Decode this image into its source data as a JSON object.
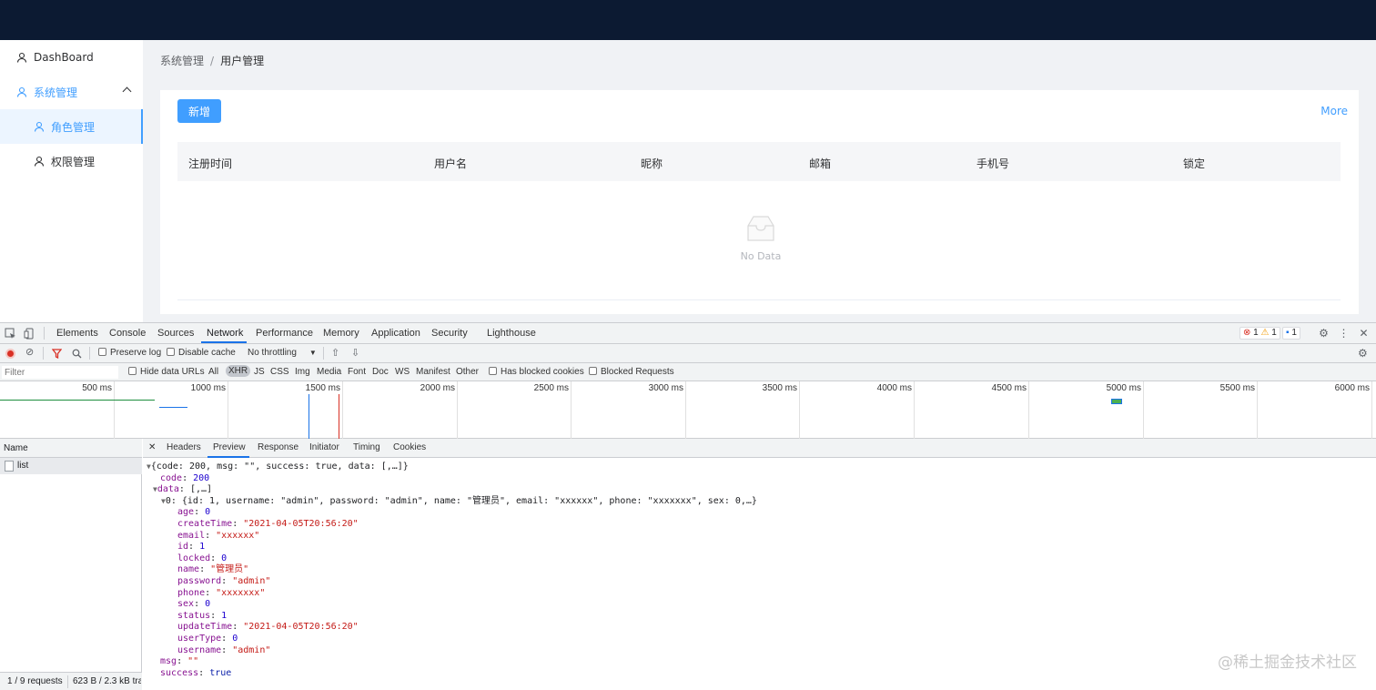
{
  "sidebar": {
    "items": [
      {
        "label": "DashBoard"
      },
      {
        "label": "系统管理"
      },
      {
        "label": "角色管理"
      },
      {
        "label": "权限管理"
      }
    ]
  },
  "breadcrumb": {
    "parent": "系统管理",
    "separator": "/",
    "current": "用户管理"
  },
  "card": {
    "add_label": "新增",
    "more_label": "More",
    "columns": [
      "注册时间",
      "用户名",
      "昵称",
      "邮箱",
      "手机号",
      "锁定"
    ],
    "empty_text": "No Data"
  },
  "devtools": {
    "tabs": [
      "Elements",
      "Console",
      "Sources",
      "Network",
      "Performance",
      "Memory",
      "Application",
      "Security",
      "Lighthouse"
    ],
    "active_tab": "Network",
    "badges": {
      "errors": "1",
      "warnings": "1",
      "messages": "1"
    },
    "toolbar": {
      "preserve_log": "Preserve log",
      "disable_cache": "Disable cache",
      "throttling": "No throttling"
    },
    "filter": {
      "placeholder": "Filter",
      "hide_data_urls": "Hide data URLs",
      "types": [
        "All",
        "XHR",
        "JS",
        "CSS",
        "Img",
        "Media",
        "Font",
        "Doc",
        "WS",
        "Manifest",
        "Other"
      ],
      "active_type": "XHR",
      "has_blocked_cookies": "Has blocked cookies",
      "blocked_requests": "Blocked Requests"
    },
    "timeline_ticks": [
      "500 ms",
      "1000 ms",
      "1500 ms",
      "2000 ms",
      "2500 ms",
      "3000 ms",
      "3500 ms",
      "4000 ms",
      "4500 ms",
      "5000 ms",
      "5500 ms",
      "6000 ms"
    ],
    "requests": {
      "header": "Name",
      "items": [
        "list"
      ],
      "footer_count": "1 / 9 requests",
      "footer_size": "623 B / 2.3 kB tra"
    },
    "detail_tabs": [
      "Headers",
      "Preview",
      "Response",
      "Initiator",
      "Timing",
      "Cookies"
    ],
    "active_detail_tab": "Preview",
    "preview": {
      "summary": "{code: 200, msg: \"\", success: true, data: [,…]}",
      "code_key": "code",
      "code_val": "200",
      "data_key": "data",
      "data_summary": "[,…]",
      "item_summary": "0: {id: 1, username: \"admin\", password: \"admin\", name: \"管理员\", email: \"xxxxxx\", phone: \"xxxxxxx\", sex: 0,…}",
      "fields": [
        {
          "key": "age",
          "value": "0",
          "type": "n"
        },
        {
          "key": "createTime",
          "value": "\"2021-04-05T20:56:20\"",
          "type": "s"
        },
        {
          "key": "email",
          "value": "\"xxxxxx\"",
          "type": "s"
        },
        {
          "key": "id",
          "value": "1",
          "type": "n"
        },
        {
          "key": "locked",
          "value": "0",
          "type": "n"
        },
        {
          "key": "name",
          "value": "\"管理员\"",
          "type": "s"
        },
        {
          "key": "password",
          "value": "\"admin\"",
          "type": "s"
        },
        {
          "key": "phone",
          "value": "\"xxxxxxx\"",
          "type": "s"
        },
        {
          "key": "sex",
          "value": "0",
          "type": "n"
        },
        {
          "key": "status",
          "value": "1",
          "type": "n"
        },
        {
          "key": "updateTime",
          "value": "\"2021-04-05T20:56:20\"",
          "type": "s"
        },
        {
          "key": "userType",
          "value": "0",
          "type": "n"
        },
        {
          "key": "username",
          "value": "\"admin\"",
          "type": "s"
        }
      ],
      "msg_key": "msg",
      "msg_val": "\"\"",
      "success_key": "success",
      "success_val": "true"
    }
  },
  "watermark": "@稀土掘金技术社区",
  "colors": {
    "topbar": "#0c1a32",
    "accent": "#409eff",
    "devtools_blue": "#1a73e8"
  }
}
